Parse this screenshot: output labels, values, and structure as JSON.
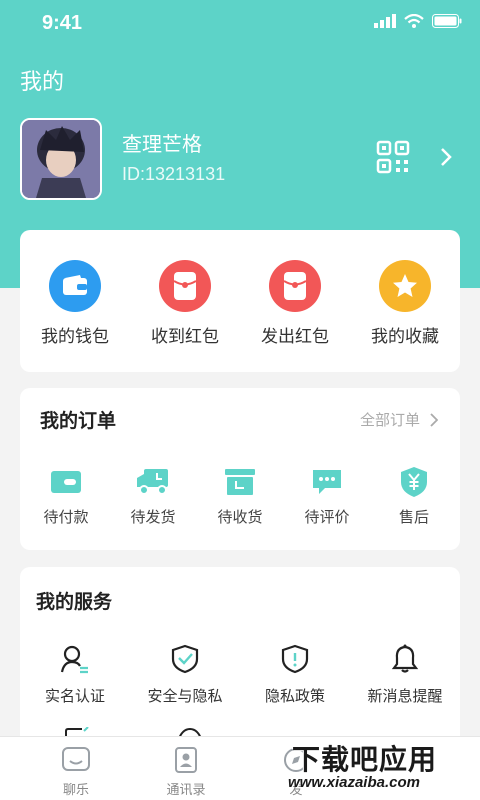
{
  "status_bar": {
    "time": "9:41"
  },
  "header": {
    "title": "我的"
  },
  "profile": {
    "nickname": "查理芒格",
    "user_id": "ID:13213131"
  },
  "wallet": {
    "items": [
      {
        "label": "我的钱包",
        "icon": "wallet-icon",
        "color": "#2d9cf0"
      },
      {
        "label": "收到红包",
        "icon": "red-packet-icon",
        "color": "#f25757"
      },
      {
        "label": "发出红包",
        "icon": "red-packet-icon",
        "color": "#f25757"
      },
      {
        "label": "我的收藏",
        "icon": "star-icon",
        "color": "#f7b52b"
      }
    ]
  },
  "orders": {
    "title": "我的订单",
    "all_label": "全部订单",
    "items": [
      {
        "label": "待付款",
        "icon": "wallet-card-icon"
      },
      {
        "label": "待发货",
        "icon": "truck-icon"
      },
      {
        "label": "待收货",
        "icon": "box-icon"
      },
      {
        "label": "待评价",
        "icon": "comment-icon"
      },
      {
        "label": "售后",
        "icon": "shield-yen-icon"
      }
    ],
    "accent": "#5dd3c8"
  },
  "services": {
    "title": "我的服务",
    "items": [
      {
        "label": "实名认证",
        "icon": "user-verify-icon"
      },
      {
        "label": "安全与隐私",
        "icon": "shield-check-icon"
      },
      {
        "label": "隐私政策",
        "icon": "shield-alert-icon"
      },
      {
        "label": "新消息提醒",
        "icon": "bell-icon"
      }
    ]
  },
  "tabbar": {
    "items": [
      {
        "label": "聊乐",
        "icon": "chat-face-icon"
      },
      {
        "label": "通讯录",
        "icon": "contacts-icon"
      },
      {
        "label": "发",
        "icon": "discover-icon"
      }
    ]
  },
  "watermark": {
    "title": "下载吧应用",
    "url": "www.xiazaiba.com"
  },
  "colors": {
    "brand": "#5dd3c8",
    "background": "#f3f3f3"
  }
}
